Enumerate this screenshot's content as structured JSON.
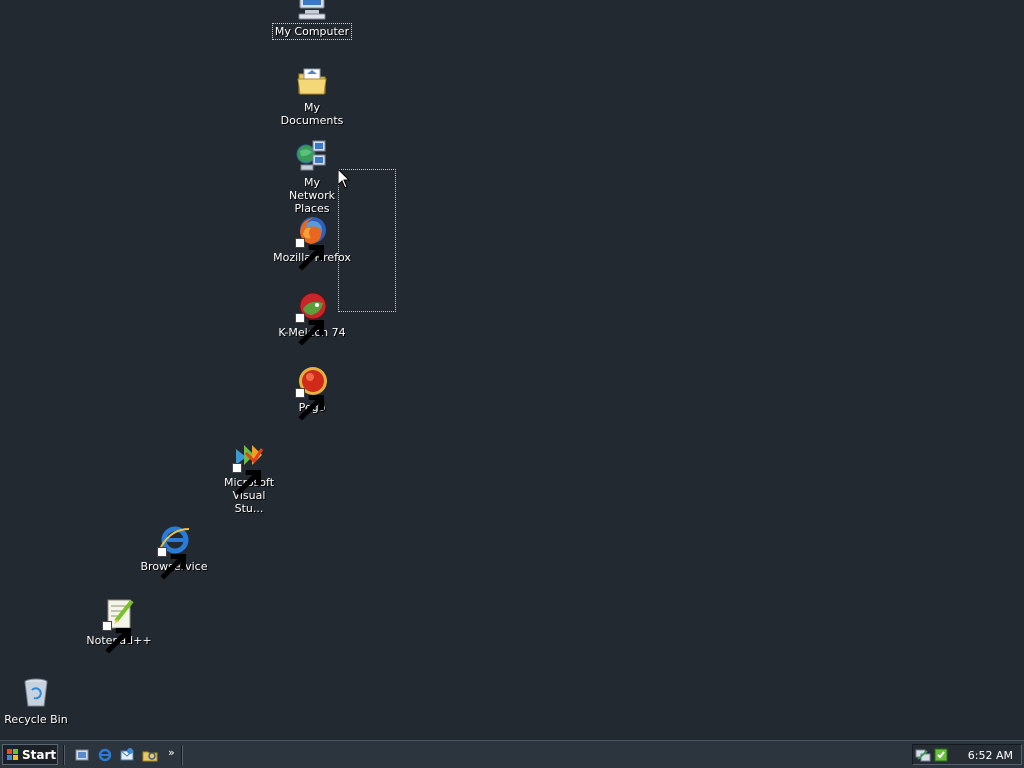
{
  "desktop": {
    "icons": [
      {
        "label": "My Computer",
        "icon": "my-computer-icon"
      },
      {
        "label": "My Documents",
        "icon": "my-documents-icon"
      },
      {
        "label": "My Network Places",
        "icon": "my-network-places-icon"
      },
      {
        "label": "Mozilla Firefox",
        "icon": "firefox-icon"
      },
      {
        "label": "K-Meleon 74",
        "icon": "k-meleon-icon"
      },
      {
        "label": "Pego",
        "icon": "pego-icon"
      },
      {
        "label": "Microsoft Visual Stu...",
        "icon": "visual-studio-icon"
      },
      {
        "label": "Browservice",
        "icon": "internet-explorer-icon"
      },
      {
        "label": "Notepad++",
        "icon": "notepad-plus-plus-icon"
      },
      {
        "label": "Recycle Bin",
        "icon": "recycle-bin-icon"
      }
    ]
  },
  "taskbar": {
    "start_label": "Start",
    "quick_launch": [
      {
        "icon": "show-desktop-icon"
      },
      {
        "icon": "internet-explorer-icon"
      },
      {
        "icon": "outlook-express-icon"
      },
      {
        "icon": "windows-explorer-icon"
      }
    ],
    "more_label": "»",
    "tray": {
      "icons": [
        "network-icon",
        "security-icon"
      ],
      "clock": "6:52 AM"
    }
  },
  "colors": {
    "desktop_background": "#232931",
    "taskbar_background": "#2c343d",
    "text": "#ffffff"
  }
}
